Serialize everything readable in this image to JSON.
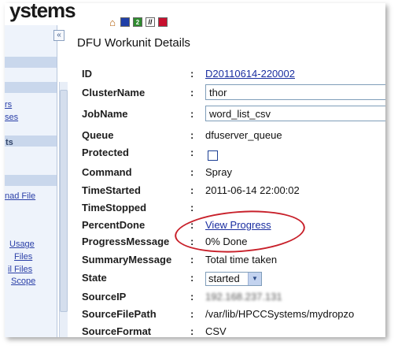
{
  "header": {
    "logo_text": "ystems",
    "toolbar_icons": [
      "home-icon",
      "blue-square-icon",
      "green-2-icon",
      "slash-icon",
      "red-square-icon"
    ],
    "toolbar_glyphs": {
      "home": "⌂",
      "green": "2",
      "slash": "//"
    }
  },
  "sidebar": {
    "collapse_glyph": "«",
    "links": [
      {
        "label": "rs"
      },
      {
        "label": "ses"
      },
      {
        "label": "nad File"
      },
      {
        "label": "Usage"
      },
      {
        "label": "Files"
      },
      {
        "label": "il Files"
      },
      {
        "label": "Scope"
      }
    ],
    "bold_items": [
      {
        "label": "ts"
      }
    ]
  },
  "page": {
    "title": "DFU Workunit Details"
  },
  "fields": {
    "id": {
      "label": "ID",
      "value": "D20110614-220002"
    },
    "cluster": {
      "label": "ClusterName",
      "value": "thor"
    },
    "jobname": {
      "label": "JobName",
      "value": "word_list_csv"
    },
    "queue": {
      "label": "Queue",
      "value": "dfuserver_queue"
    },
    "protected": {
      "label": "Protected",
      "checked": false
    },
    "command": {
      "label": "Command",
      "value": "Spray"
    },
    "time_started": {
      "label": "TimeStarted",
      "value": "2011-06-14 22:00:02"
    },
    "time_stopped": {
      "label": "TimeStopped",
      "value": ""
    },
    "percent_done": {
      "label": "PercentDone",
      "value": "View Progress"
    },
    "progress_message": {
      "label": "ProgressMessage",
      "value": "0% Done"
    },
    "summary_message": {
      "label": "SummaryMessage",
      "value": "Total time taken"
    },
    "state": {
      "label": "State",
      "value": "started",
      "arrow": "▼"
    },
    "source_ip": {
      "label": "SourceIP",
      "value": "192.168.237.131"
    },
    "source_file_path": {
      "label": "SourceFilePath",
      "value": "/var/lib/HPCCSystems/mydropzo"
    },
    "source_format": {
      "label": "SourceFormat",
      "value": "CSV"
    }
  },
  "colon": ":",
  "colors": {
    "annotation_ellipse": "#c8202a",
    "link": "#1a2ea0",
    "sidebar_bg": "#eef3fb"
  }
}
